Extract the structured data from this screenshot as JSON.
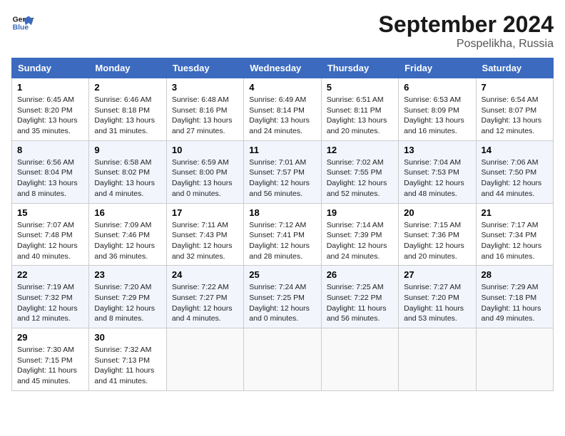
{
  "header": {
    "logo_line1": "General",
    "logo_line2": "Blue",
    "month_title": "September 2024",
    "location": "Pospelikha, Russia"
  },
  "weekdays": [
    "Sunday",
    "Monday",
    "Tuesday",
    "Wednesday",
    "Thursday",
    "Friday",
    "Saturday"
  ],
  "weeks": [
    [
      {
        "day": "1",
        "info": "Sunrise: 6:45 AM\nSunset: 8:20 PM\nDaylight: 13 hours\nand 35 minutes."
      },
      {
        "day": "2",
        "info": "Sunrise: 6:46 AM\nSunset: 8:18 PM\nDaylight: 13 hours\nand 31 minutes."
      },
      {
        "day": "3",
        "info": "Sunrise: 6:48 AM\nSunset: 8:16 PM\nDaylight: 13 hours\nand 27 minutes."
      },
      {
        "day": "4",
        "info": "Sunrise: 6:49 AM\nSunset: 8:14 PM\nDaylight: 13 hours\nand 24 minutes."
      },
      {
        "day": "5",
        "info": "Sunrise: 6:51 AM\nSunset: 8:11 PM\nDaylight: 13 hours\nand 20 minutes."
      },
      {
        "day": "6",
        "info": "Sunrise: 6:53 AM\nSunset: 8:09 PM\nDaylight: 13 hours\nand 16 minutes."
      },
      {
        "day": "7",
        "info": "Sunrise: 6:54 AM\nSunset: 8:07 PM\nDaylight: 13 hours\nand 12 minutes."
      }
    ],
    [
      {
        "day": "8",
        "info": "Sunrise: 6:56 AM\nSunset: 8:04 PM\nDaylight: 13 hours\nand 8 minutes."
      },
      {
        "day": "9",
        "info": "Sunrise: 6:58 AM\nSunset: 8:02 PM\nDaylight: 13 hours\nand 4 minutes."
      },
      {
        "day": "10",
        "info": "Sunrise: 6:59 AM\nSunset: 8:00 PM\nDaylight: 13 hours\nand 0 minutes."
      },
      {
        "day": "11",
        "info": "Sunrise: 7:01 AM\nSunset: 7:57 PM\nDaylight: 12 hours\nand 56 minutes."
      },
      {
        "day": "12",
        "info": "Sunrise: 7:02 AM\nSunset: 7:55 PM\nDaylight: 12 hours\nand 52 minutes."
      },
      {
        "day": "13",
        "info": "Sunrise: 7:04 AM\nSunset: 7:53 PM\nDaylight: 12 hours\nand 48 minutes."
      },
      {
        "day": "14",
        "info": "Sunrise: 7:06 AM\nSunset: 7:50 PM\nDaylight: 12 hours\nand 44 minutes."
      }
    ],
    [
      {
        "day": "15",
        "info": "Sunrise: 7:07 AM\nSunset: 7:48 PM\nDaylight: 12 hours\nand 40 minutes."
      },
      {
        "day": "16",
        "info": "Sunrise: 7:09 AM\nSunset: 7:46 PM\nDaylight: 12 hours\nand 36 minutes."
      },
      {
        "day": "17",
        "info": "Sunrise: 7:11 AM\nSunset: 7:43 PM\nDaylight: 12 hours\nand 32 minutes."
      },
      {
        "day": "18",
        "info": "Sunrise: 7:12 AM\nSunset: 7:41 PM\nDaylight: 12 hours\nand 28 minutes."
      },
      {
        "day": "19",
        "info": "Sunrise: 7:14 AM\nSunset: 7:39 PM\nDaylight: 12 hours\nand 24 minutes."
      },
      {
        "day": "20",
        "info": "Sunrise: 7:15 AM\nSunset: 7:36 PM\nDaylight: 12 hours\nand 20 minutes."
      },
      {
        "day": "21",
        "info": "Sunrise: 7:17 AM\nSunset: 7:34 PM\nDaylight: 12 hours\nand 16 minutes."
      }
    ],
    [
      {
        "day": "22",
        "info": "Sunrise: 7:19 AM\nSunset: 7:32 PM\nDaylight: 12 hours\nand 12 minutes."
      },
      {
        "day": "23",
        "info": "Sunrise: 7:20 AM\nSunset: 7:29 PM\nDaylight: 12 hours\nand 8 minutes."
      },
      {
        "day": "24",
        "info": "Sunrise: 7:22 AM\nSunset: 7:27 PM\nDaylight: 12 hours\nand 4 minutes."
      },
      {
        "day": "25",
        "info": "Sunrise: 7:24 AM\nSunset: 7:25 PM\nDaylight: 12 hours\nand 0 minutes."
      },
      {
        "day": "26",
        "info": "Sunrise: 7:25 AM\nSunset: 7:22 PM\nDaylight: 11 hours\nand 56 minutes."
      },
      {
        "day": "27",
        "info": "Sunrise: 7:27 AM\nSunset: 7:20 PM\nDaylight: 11 hours\nand 53 minutes."
      },
      {
        "day": "28",
        "info": "Sunrise: 7:29 AM\nSunset: 7:18 PM\nDaylight: 11 hours\nand 49 minutes."
      }
    ],
    [
      {
        "day": "29",
        "info": "Sunrise: 7:30 AM\nSunset: 7:15 PM\nDaylight: 11 hours\nand 45 minutes."
      },
      {
        "day": "30",
        "info": "Sunrise: 7:32 AM\nSunset: 7:13 PM\nDaylight: 11 hours\nand 41 minutes."
      },
      {
        "day": "",
        "info": ""
      },
      {
        "day": "",
        "info": ""
      },
      {
        "day": "",
        "info": ""
      },
      {
        "day": "",
        "info": ""
      },
      {
        "day": "",
        "info": ""
      }
    ]
  ]
}
